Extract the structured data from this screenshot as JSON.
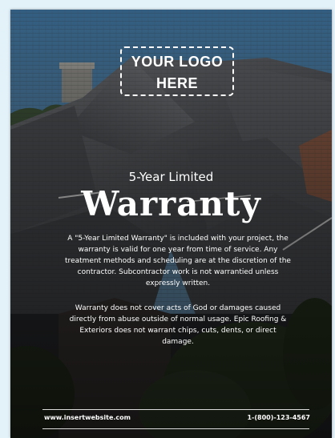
{
  "logo": {
    "line1": "YOUR LOGO",
    "line2": "HERE"
  },
  "heading": {
    "subtitle": "5-Year Limited",
    "title": "Warranty"
  },
  "body": {
    "paragraph1": "A \"5-Year Limited Warranty\" is included with your project, the warranty is valid for one year from time of service. Any treatment methods and scheduling are at the discretion of the contractor. Subcontractor work is not warrantied unless expressly written.",
    "paragraph2": "Warranty does not cover acts of God or damages caused directly from abuse outside of normal usage. Epic Roofing & Exteriors does not warrant chips, cuts, dents, or direct damage."
  },
  "footer": {
    "website": "www.insertwebsite.com",
    "phone": "1-(800)-123-4567"
  },
  "colors": {
    "sky": "#4a7fa8",
    "roof": "#55575b",
    "overlay": "#1a1c20",
    "text": "#ffffff"
  }
}
